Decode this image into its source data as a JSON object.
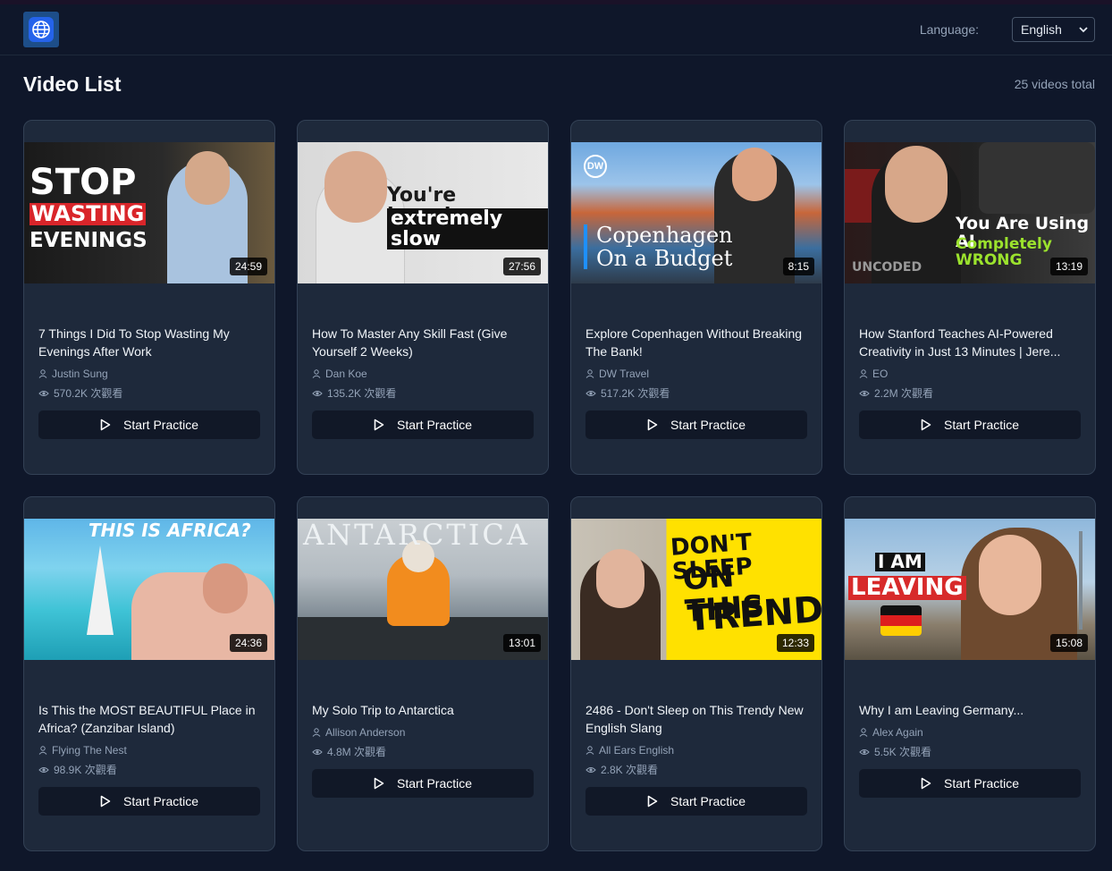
{
  "header": {
    "language_label": "Language:",
    "language_selected": "English"
  },
  "page": {
    "title": "Video List",
    "total": "25 videos total"
  },
  "button_label": "Start Practice",
  "videos": [
    {
      "title": "7 Things I Did To Stop Wasting My Evenings After Work",
      "author": "Justin Sung",
      "views": "570.2K 次觀看",
      "duration": "24:59",
      "thumb_text": [
        "STOP",
        "WASTING",
        "EVENINGS"
      ]
    },
    {
      "title": "How To Master Any Skill Fast (Give Yourself 2 Weeks)",
      "author": "Dan Koe",
      "views": "135.2K 次觀看",
      "duration": "27:56",
      "thumb_text": [
        "You're learning",
        "extremely slow"
      ]
    },
    {
      "title": "Explore Copenhagen Without Breaking The Bank!",
      "author": "DW Travel",
      "views": "517.2K 次觀看",
      "duration": "8:15",
      "thumb_text": [
        "Copenhagen",
        "On a Budget",
        "DW"
      ]
    },
    {
      "title": "How Stanford Teaches AI-Powered Creativity in Just 13 Minutes | Jere...",
      "author": "EO",
      "views": "2.2M 次觀看",
      "duration": "13:19",
      "thumb_text": [
        "You Are Using AI",
        "Completely WRONG",
        "UNCODED"
      ]
    },
    {
      "title": "Is This the MOST BEAUTIFUL Place in Africa? (Zanzibar Island)",
      "author": "Flying The Nest",
      "views": "98.9K 次觀看",
      "duration": "24:36",
      "thumb_text": [
        "THIS IS AFRICA?"
      ]
    },
    {
      "title": "My Solo Trip to Antarctica",
      "author": "Allison Anderson",
      "views": "4.8M 次觀看",
      "duration": "13:01",
      "thumb_text": [
        "ANTARCTICA"
      ]
    },
    {
      "title": "2486 - Don't Sleep on This Trendy New English Slang",
      "author": "All Ears English",
      "views": "2.8K 次觀看",
      "duration": "12:33",
      "thumb_text": [
        "DON'T SLEEP",
        "ON THIS",
        "TREND"
      ]
    },
    {
      "title": "Why I am Leaving Germany...",
      "author": "Alex Again",
      "views": "5.5K 次觀看",
      "duration": "15:08",
      "thumb_text": [
        "I AM",
        "LEAVING"
      ]
    }
  ],
  "colors": {
    "background": "#0f172a",
    "card": "#1e293b",
    "button": "#111827"
  }
}
